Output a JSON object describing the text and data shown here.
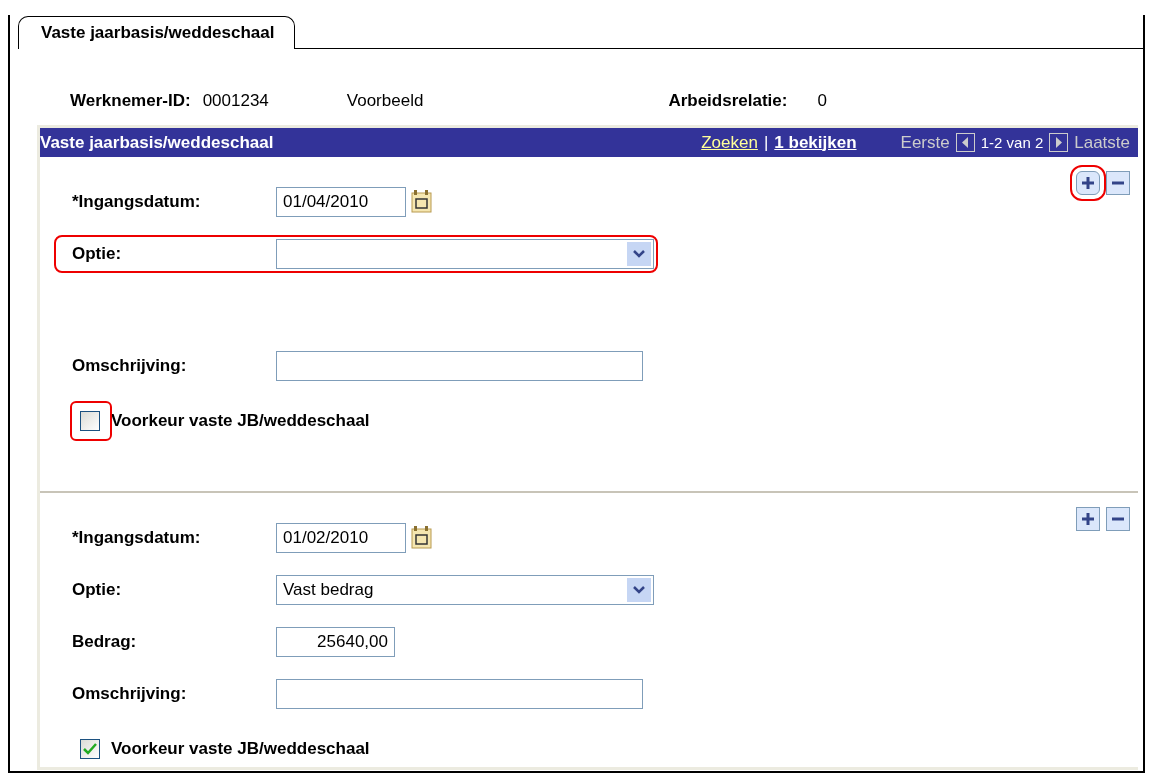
{
  "tab": {
    "label": "Vaste jaarbasis/weddeschaal",
    "selected": true
  },
  "header": {
    "employee_label": "Werknemer-ID:",
    "employee_id": "0001234",
    "employee_name": "Voorbeeld",
    "relation_label": "Arbeidsrelatie:",
    "relation_value": "0"
  },
  "panel": {
    "title": "Vaste jaarbasis/weddeschaal",
    "search_link": "Zoeken",
    "separator": "|",
    "view_link": "1 bekijken",
    "first": "Eerste",
    "range": "1-2 van 2",
    "last": "Laatste"
  },
  "records": [
    {
      "date_label": "*Ingangsdatum:",
      "date": "01/04/2010",
      "option_label": "Optie:",
      "option_highlighted": true,
      "add_highlighted": true,
      "description_label": "Omschrijving:",
      "preference_label": "Voorkeur vaste JB/weddeschaal",
      "checked": false,
      "checkbox_highlighted": true
    },
    {
      "date_label": "*Ingangsdatum:",
      "date": "01/02/2010",
      "option_label": "Optie:",
      "option": "Vast bedrag",
      "option_highlighted": false,
      "add_highlighted": false,
      "amount_label": "Bedrag:",
      "amount": "25640,00",
      "description_label": "Omschrijving:",
      "preference_label": "Voorkeur vaste JB/weddeschaal",
      "checked": true,
      "checkbox_highlighted": false
    }
  ]
}
